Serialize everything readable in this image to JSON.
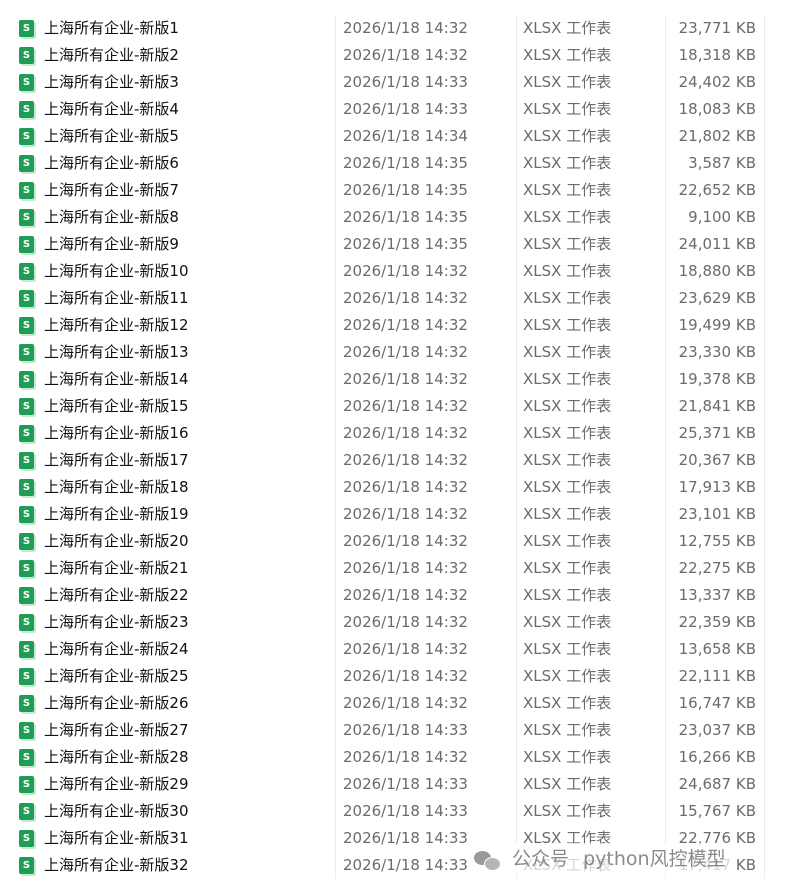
{
  "file_list": {
    "icon": "xlsx-file-icon",
    "rows": [
      {
        "name": "上海所有企业-新版1",
        "modified": "2026/1/18 14:32",
        "type": "XLSX 工作表",
        "size": "23,771 KB"
      },
      {
        "name": "上海所有企业-新版2",
        "modified": "2026/1/18 14:32",
        "type": "XLSX 工作表",
        "size": "18,318 KB"
      },
      {
        "name": "上海所有企业-新版3",
        "modified": "2026/1/18 14:33",
        "type": "XLSX 工作表",
        "size": "24,402 KB"
      },
      {
        "name": "上海所有企业-新版4",
        "modified": "2026/1/18 14:33",
        "type": "XLSX 工作表",
        "size": "18,083 KB"
      },
      {
        "name": "上海所有企业-新版5",
        "modified": "2026/1/18 14:34",
        "type": "XLSX 工作表",
        "size": "21,802 KB"
      },
      {
        "name": "上海所有企业-新版6",
        "modified": "2026/1/18 14:35",
        "type": "XLSX 工作表",
        "size": "3,587 KB"
      },
      {
        "name": "上海所有企业-新版7",
        "modified": "2026/1/18 14:35",
        "type": "XLSX 工作表",
        "size": "22,652 KB"
      },
      {
        "name": "上海所有企业-新版8",
        "modified": "2026/1/18 14:35",
        "type": "XLSX 工作表",
        "size": "9,100 KB"
      },
      {
        "name": "上海所有企业-新版9",
        "modified": "2026/1/18 14:35",
        "type": "XLSX 工作表",
        "size": "24,011 KB"
      },
      {
        "name": "上海所有企业-新版10",
        "modified": "2026/1/18 14:32",
        "type": "XLSX 工作表",
        "size": "18,880 KB"
      },
      {
        "name": "上海所有企业-新版11",
        "modified": "2026/1/18 14:32",
        "type": "XLSX 工作表",
        "size": "23,629 KB"
      },
      {
        "name": "上海所有企业-新版12",
        "modified": "2026/1/18 14:32",
        "type": "XLSX 工作表",
        "size": "19,499 KB"
      },
      {
        "name": "上海所有企业-新版13",
        "modified": "2026/1/18 14:32",
        "type": "XLSX 工作表",
        "size": "23,330 KB"
      },
      {
        "name": "上海所有企业-新版14",
        "modified": "2026/1/18 14:32",
        "type": "XLSX 工作表",
        "size": "19,378 KB"
      },
      {
        "name": "上海所有企业-新版15",
        "modified": "2026/1/18 14:32",
        "type": "XLSX 工作表",
        "size": "21,841 KB"
      },
      {
        "name": "上海所有企业-新版16",
        "modified": "2026/1/18 14:32",
        "type": "XLSX 工作表",
        "size": "25,371 KB"
      },
      {
        "name": "上海所有企业-新版17",
        "modified": "2026/1/18 14:32",
        "type": "XLSX 工作表",
        "size": "20,367 KB"
      },
      {
        "name": "上海所有企业-新版18",
        "modified": "2026/1/18 14:32",
        "type": "XLSX 工作表",
        "size": "17,913 KB"
      },
      {
        "name": "上海所有企业-新版19",
        "modified": "2026/1/18 14:32",
        "type": "XLSX 工作表",
        "size": "23,101 KB"
      },
      {
        "name": "上海所有企业-新版20",
        "modified": "2026/1/18 14:32",
        "type": "XLSX 工作表",
        "size": "12,755 KB"
      },
      {
        "name": "上海所有企业-新版21",
        "modified": "2026/1/18 14:32",
        "type": "XLSX 工作表",
        "size": "22,275 KB"
      },
      {
        "name": "上海所有企业-新版22",
        "modified": "2026/1/18 14:32",
        "type": "XLSX 工作表",
        "size": "13,337 KB"
      },
      {
        "name": "上海所有企业-新版23",
        "modified": "2026/1/18 14:32",
        "type": "XLSX 工作表",
        "size": "22,359 KB"
      },
      {
        "name": "上海所有企业-新版24",
        "modified": "2026/1/18 14:32",
        "type": "XLSX 工作表",
        "size": "13,658 KB"
      },
      {
        "name": "上海所有企业-新版25",
        "modified": "2026/1/18 14:32",
        "type": "XLSX 工作表",
        "size": "22,111 KB"
      },
      {
        "name": "上海所有企业-新版26",
        "modified": "2026/1/18 14:32",
        "type": "XLSX 工作表",
        "size": "16,747 KB"
      },
      {
        "name": "上海所有企业-新版27",
        "modified": "2026/1/18 14:33",
        "type": "XLSX 工作表",
        "size": "23,037 KB"
      },
      {
        "name": "上海所有企业-新版28",
        "modified": "2026/1/18 14:32",
        "type": "XLSX 工作表",
        "size": "16,266 KB"
      },
      {
        "name": "上海所有企业-新版29",
        "modified": "2026/1/18 14:33",
        "type": "XLSX 工作表",
        "size": "24,687 KB"
      },
      {
        "name": "上海所有企业-新版30",
        "modified": "2026/1/18 14:33",
        "type": "XLSX 工作表",
        "size": "15,767 KB"
      },
      {
        "name": "上海所有企业-新版31",
        "modified": "2026/1/18 14:33",
        "type": "XLSX 工作表",
        "size": "22,776 KB"
      },
      {
        "name": "上海所有企业-新版32",
        "modified": "2026/1/18 14:33",
        "type": "XLSX 工作表",
        "size": "17,417 KB"
      }
    ]
  },
  "watermark": {
    "icon": "wechat-icon",
    "label": "公众号",
    "account": "python风控模型"
  },
  "colors": {
    "xlsx_icon": "#1f9d55",
    "secondary_text": "#6b6b6b",
    "primary_text": "#111111",
    "column_separator": "#ebebeb"
  }
}
